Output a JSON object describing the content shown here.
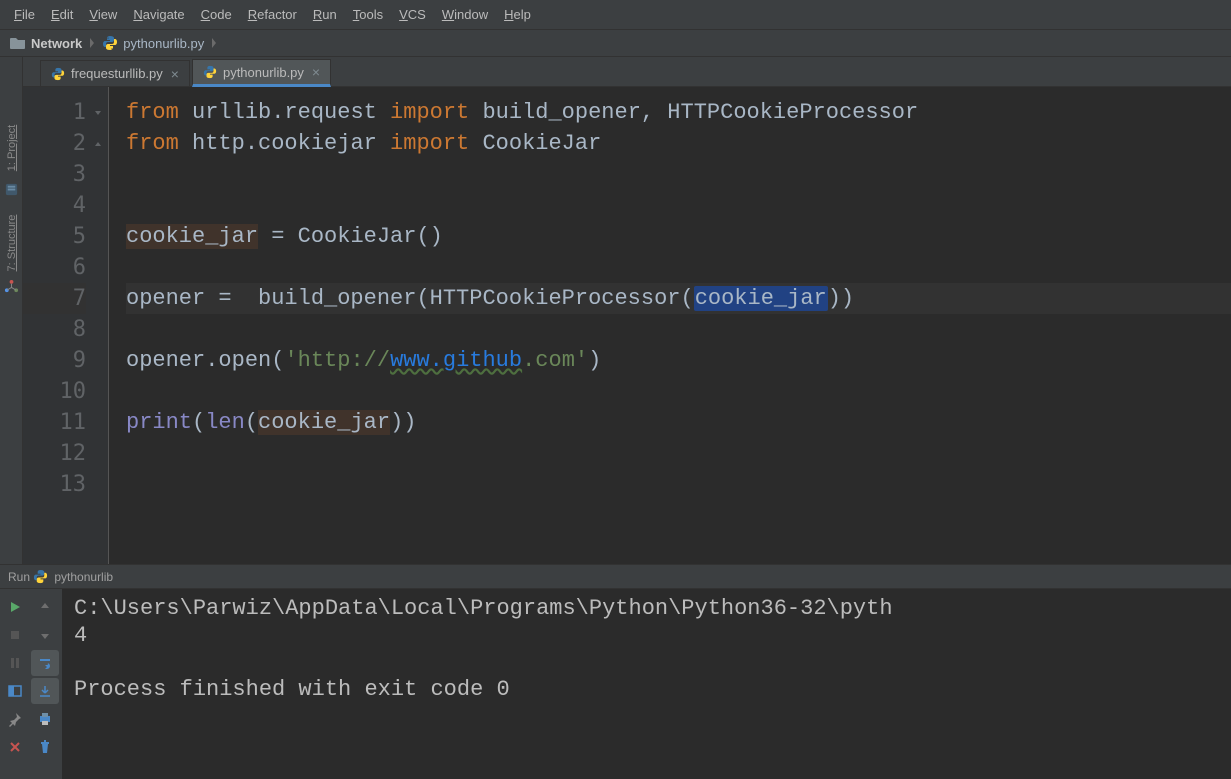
{
  "menu": [
    "File",
    "Edit",
    "View",
    "Navigate",
    "Code",
    "Refactor",
    "Run",
    "Tools",
    "VCS",
    "Window",
    "Help"
  ],
  "breadcrumb": {
    "folder": "Network",
    "file": "pythonurlib.py"
  },
  "tabs": [
    {
      "label": "frequesturllib.py",
      "active": false
    },
    {
      "label": "pythonurlib.py",
      "active": true
    }
  ],
  "sideTools": {
    "project": "1: Project",
    "structure": "7: Structure"
  },
  "editor": {
    "lines": [
      {
        "n": "1",
        "html": "<span class='kw'>from</span> urllib.request <span class='kw'>import</span> build_opener<span class='punct'>,</span> HTTPCookieProcessor"
      },
      {
        "n": "2",
        "html": "<span class='kw'>from</span> http.cookiejar <span class='kw'>import</span> CookieJar"
      },
      {
        "n": "3",
        "html": ""
      },
      {
        "n": "4",
        "html": ""
      },
      {
        "n": "5",
        "html": "<span class='hl-ident'>cookie_jar</span> = CookieJar()"
      },
      {
        "n": "6",
        "html": ""
      },
      {
        "n": "7",
        "hl": true,
        "html": "opener =  build_opener(HTTPCookieProcessor(<span class='selbox'>cookie_jar</span>))"
      },
      {
        "n": "8",
        "html": ""
      },
      {
        "n": "9",
        "html": "opener.open(<span class='str'>'http://</span><span class='link'>www.github</span><span class='str'>.com'</span>)"
      },
      {
        "n": "10",
        "html": ""
      },
      {
        "n": "11",
        "html": "<span class='builtin'>print</span>(<span class='builtin'>len</span>(<span class='hl-ident'>cookie_jar</span>))"
      },
      {
        "n": "12",
        "html": ""
      },
      {
        "n": "13",
        "html": ""
      }
    ]
  },
  "run": {
    "label": "Run",
    "config": "pythonurlib",
    "output": "C:\\Users\\Parwiz\\AppData\\Local\\Programs\\Python\\Python36-32\\pyth\n4\n\nProcess finished with exit code 0"
  }
}
